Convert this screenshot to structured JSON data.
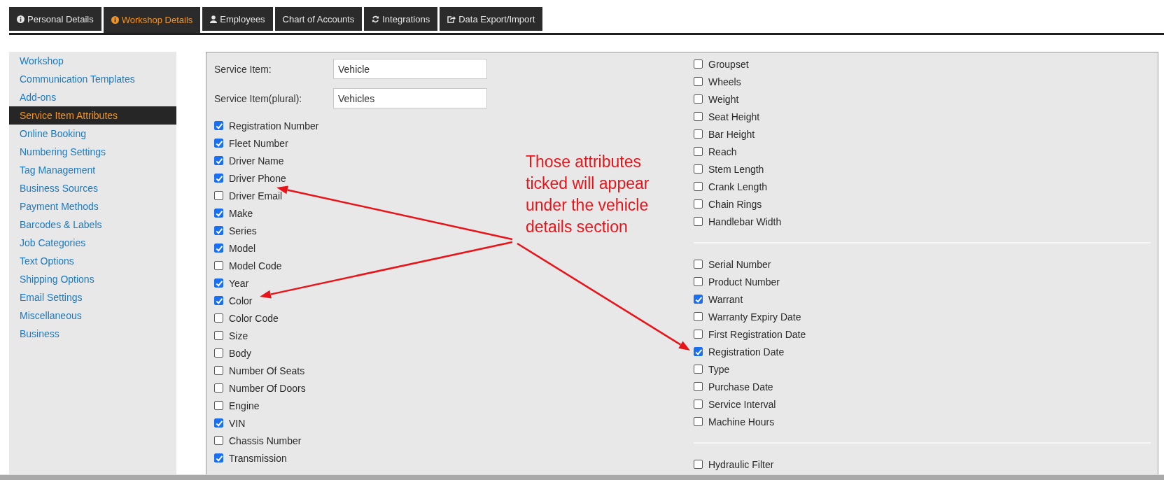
{
  "tabs": [
    {
      "label": "Personal Details",
      "selected": false
    },
    {
      "label": "Workshop Details",
      "selected": true
    },
    {
      "label": "Employees",
      "selected": false
    },
    {
      "label": "Chart of Accounts",
      "selected": false
    },
    {
      "label": "Integrations",
      "selected": false
    },
    {
      "label": "Data Export/Import",
      "selected": false
    }
  ],
  "sidebar": {
    "items": [
      {
        "label": "Workshop",
        "selected": false
      },
      {
        "label": "Communication Templates",
        "selected": false
      },
      {
        "label": "Add-ons",
        "selected": false
      },
      {
        "label": "Service Item Attributes",
        "selected": true
      },
      {
        "label": "Online Booking",
        "selected": false
      },
      {
        "label": "Numbering Settings",
        "selected": false
      },
      {
        "label": "Tag Management",
        "selected": false
      },
      {
        "label": "Business Sources",
        "selected": false
      },
      {
        "label": "Payment Methods",
        "selected": false
      },
      {
        "label": "Barcodes & Labels",
        "selected": false
      },
      {
        "label": "Job Categories",
        "selected": false
      },
      {
        "label": "Text Options",
        "selected": false
      },
      {
        "label": "Shipping Options",
        "selected": false
      },
      {
        "label": "Email Settings",
        "selected": false
      },
      {
        "label": "Miscellaneous",
        "selected": false
      },
      {
        "label": "Business",
        "selected": false
      }
    ]
  },
  "form": {
    "fields": [
      {
        "label": "Service Item:",
        "value": "Vehicle"
      },
      {
        "label": "Service Item(plural):",
        "value": "Vehicles"
      }
    ],
    "attributes": [
      {
        "label": "Registration Number",
        "checked": true
      },
      {
        "label": "Fleet Number",
        "checked": true
      },
      {
        "label": "Driver Name",
        "checked": true
      },
      {
        "label": "Driver Phone",
        "checked": true
      },
      {
        "label": "Driver Email",
        "checked": false
      },
      {
        "label": "Make",
        "checked": true
      },
      {
        "label": "Series",
        "checked": true
      },
      {
        "label": "Model",
        "checked": true
      },
      {
        "label": "Model Code",
        "checked": false
      },
      {
        "label": "Year",
        "checked": true
      },
      {
        "label": "Color",
        "checked": true
      },
      {
        "label": "Color Code",
        "checked": false
      },
      {
        "label": "Size",
        "checked": false
      },
      {
        "label": "Body",
        "checked": false
      },
      {
        "label": "Number Of Seats",
        "checked": false
      },
      {
        "label": "Number Of Doors",
        "checked": false
      },
      {
        "label": "Engine",
        "checked": false
      },
      {
        "label": "VIN",
        "checked": true
      },
      {
        "label": "Chassis Number",
        "checked": false
      },
      {
        "label": "Transmission",
        "checked": true
      }
    ],
    "attribute_groups": [
      {
        "items": [
          {
            "label": "Groupset",
            "checked": false
          },
          {
            "label": "Wheels",
            "checked": false
          },
          {
            "label": "Weight",
            "checked": false
          },
          {
            "label": "Seat Height",
            "checked": false
          },
          {
            "label": "Bar Height",
            "checked": false
          },
          {
            "label": "Reach",
            "checked": false
          },
          {
            "label": "Stem Length",
            "checked": false
          },
          {
            "label": "Crank Length",
            "checked": false
          },
          {
            "label": "Chain Rings",
            "checked": false
          },
          {
            "label": "Handlebar Width",
            "checked": false
          }
        ]
      },
      {
        "items": [
          {
            "label": "Serial Number",
            "checked": false
          },
          {
            "label": "Product Number",
            "checked": false
          },
          {
            "label": "Warrant",
            "checked": true
          },
          {
            "label": "Warranty Expiry Date",
            "checked": false
          },
          {
            "label": "First Registration Date",
            "checked": false
          },
          {
            "label": "Registration Date",
            "checked": true
          },
          {
            "label": "Type",
            "checked": false
          },
          {
            "label": "Purchase Date",
            "checked": false
          },
          {
            "label": "Service Interval",
            "checked": false
          },
          {
            "label": "Machine Hours",
            "checked": false
          }
        ]
      },
      {
        "items": [
          {
            "label": "Hydraulic Filter",
            "checked": false
          }
        ]
      }
    ]
  },
  "annotation": {
    "text": "Those attributes ticked will appear under the vehicle details section"
  }
}
